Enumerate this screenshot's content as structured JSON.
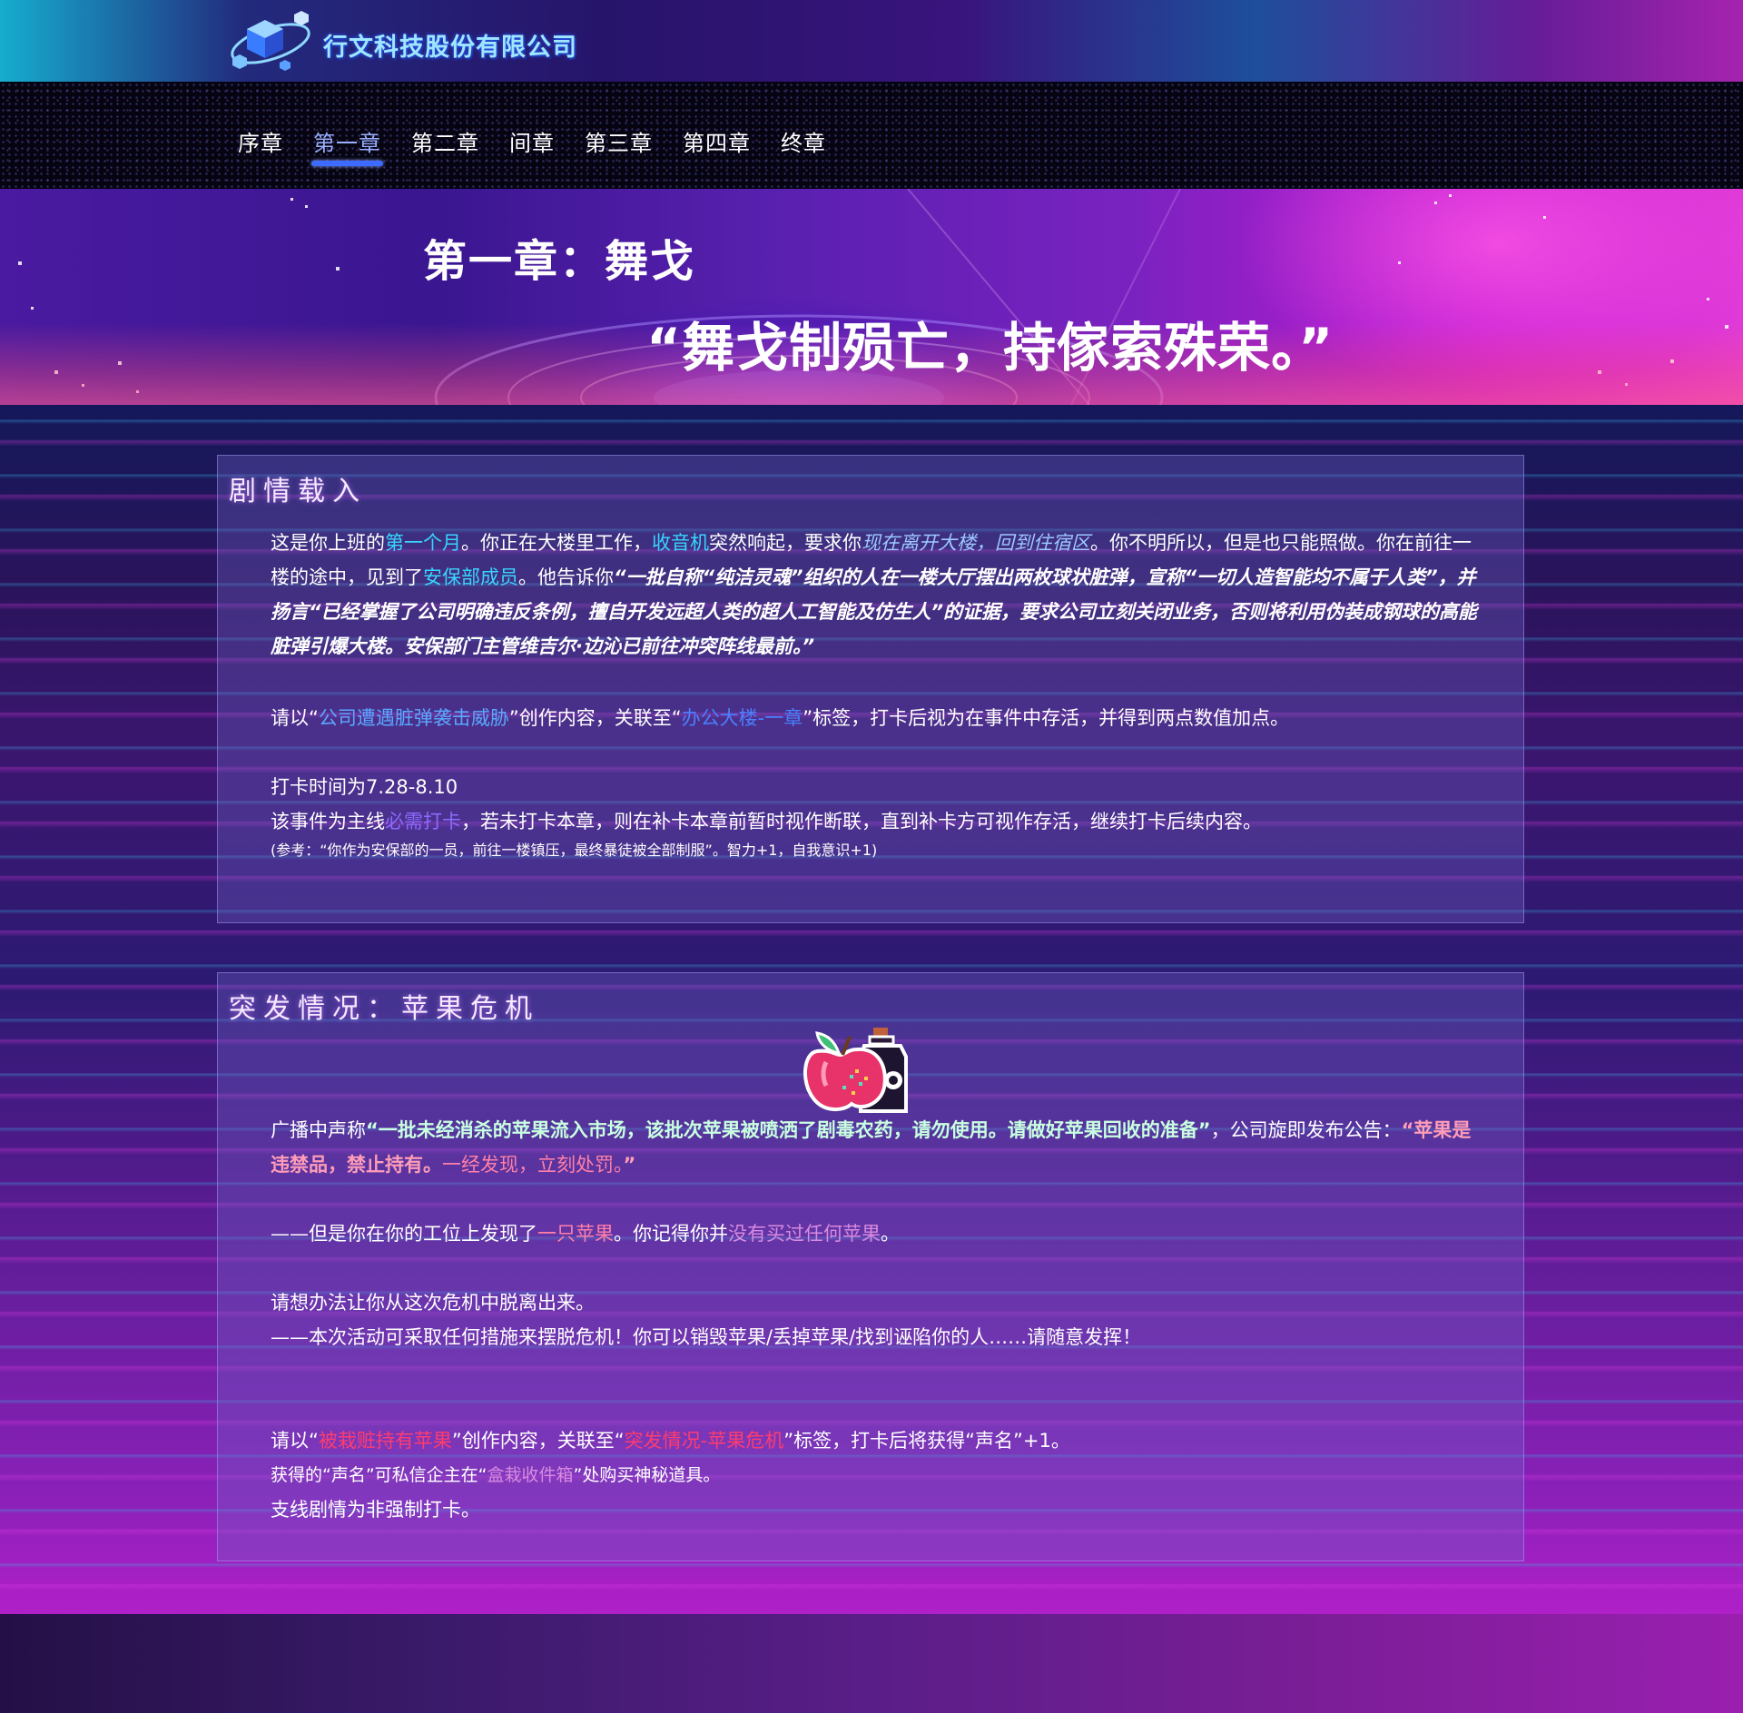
{
  "header": {
    "company_name": "行文科技股份有限公司",
    "logo_icon": "cube-logo-icon"
  },
  "nav": {
    "items": [
      "序章",
      "第一章",
      "第二章",
      "间章",
      "第三章",
      "第四章",
      "终章"
    ],
    "active_index": 1
  },
  "banner": {
    "title": "第一章：舞戈",
    "quote": "“舞戈制殒亡，持傢索殊荣。”"
  },
  "panel1": {
    "title": "剧情载入",
    "p1": {
      "t1": "这是你上班的",
      "h1": "第一个月",
      "t2": "。你正在大楼里工作，",
      "h2": "收音机",
      "t3": "突然响起，要求你",
      "h3": "现在离开大楼，回到住宿区",
      "t4": "。你不明所以，但是也只能照做。你在前往一楼的途中，见到了",
      "h4": "安保部成员",
      "t5": "。他告诉你",
      "h5": "“一批自称“纯洁灵魂”组织的人在一楼大厅摆出两枚球状脏弹，宣称“一切人造智能均不属于人类”，并扬言“已经掌握了公司明确违反条例，擅自开发远超人类的超人工智能及仿生人”的证据，要求公司立刻关闭业务，否则将利用伪装成钢球的高能脏弹引爆大楼。安保部门主管维吉尔·边沁已前往冲突阵线最前。”"
    },
    "p2": {
      "t1": "请以“",
      "h1": "公司遭遇脏弹袭击威胁",
      "t2": "”创作内容，关联至“",
      "h2": "办公大楼-一章",
      "t3": "”标签，打卡后视为在事件中存活，并得到两点数值加点。"
    },
    "p3": {
      "line1": "打卡时间为7.28-8.10",
      "t1": "该事件为主线",
      "h1": "必需打卡",
      "t2": "，若未打卡本章，则在补卡本章前暂时视作断联，直到补卡方可视作存活，继续打卡后续内容。",
      "note": "(参考：“你作为安保部的一员，前往一楼镇压，最终暴徒被全部制服”。智力+1，自我意识+1)"
    }
  },
  "panel2": {
    "title": "突发情况：苹果危机",
    "image_icon": "apple-and-poison-bottle-icon",
    "p1": {
      "t1": "广播中声称",
      "h1": "“一批未经消杀的苹果流入市场，该批次苹果被喷洒了剧毒农药，请勿使用。请做好苹果回收的准备”",
      "t2": "，公司旋即发布公告：",
      "h2": "“苹果是违禁品，禁止持有。",
      "h3": "一经发现，立刻处罚。",
      "h4": "”"
    },
    "p2": {
      "t1": "——但是你在你的工位上发现了",
      "h1": "一只苹果",
      "t2": "。你记得你并",
      "h2": "没有买过任何苹果",
      "t3": "。"
    },
    "p3": {
      "line1": "请想办法让你从这次危机中脱离出来。",
      "line2": "——本次活动可采取任何措施来摆脱危机！你可以销毁苹果/丢掉苹果/找到诬陷你的人……请随意发挥！"
    },
    "p4": {
      "t1": "请以“",
      "h1": "被栽赃持有苹果",
      "t2": "”创作内容，关联至“",
      "h2": "突发情况-苹果危机",
      "t3": "”标签，打卡后将获得“声名”+1。",
      "t4": "获得的“声名”可私信企主在“",
      "h3": "盒栽收件箱",
      "t5": "”处购买神秘道具。",
      "line3": "支线剧情为非强制打卡。"
    }
  }
}
